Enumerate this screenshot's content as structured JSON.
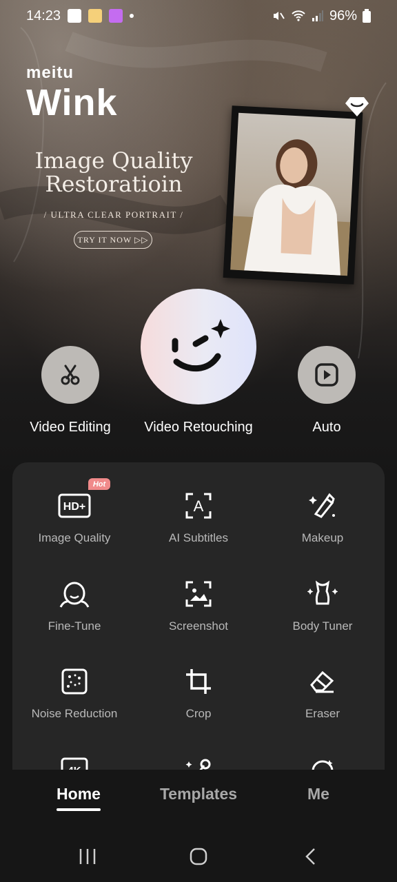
{
  "status_bar": {
    "time": "14:23",
    "battery": "96%"
  },
  "hero": {
    "brand_small": "meitu",
    "brand_big": "Wink",
    "promo_title_line1": "Image Quality",
    "promo_title_line2": "Restoratioin",
    "promo_subtitle": "/ ULTRA CLEAR PORTRAIT /",
    "cta_label": "TRY IT NOW ▷▷"
  },
  "actions": [
    {
      "label": "Video Editing",
      "icon": "scissors-icon"
    },
    {
      "label": "Video Retouching",
      "icon": "wink-face-icon"
    },
    {
      "label": "Auto",
      "icon": "play-icon"
    }
  ],
  "tools": [
    {
      "label": "Image Quality",
      "icon": "hd-plus-icon",
      "badge": "Hot"
    },
    {
      "label": "AI Subtitles",
      "icon": "subtitle-a-icon"
    },
    {
      "label": "Makeup",
      "icon": "lipstick-icon"
    },
    {
      "label": "Fine-Tune",
      "icon": "face-tune-icon"
    },
    {
      "label": "Screenshot",
      "icon": "screenshot-icon"
    },
    {
      "label": "Body Tuner",
      "icon": "body-icon"
    },
    {
      "label": "Noise Reduction",
      "icon": "noise-icon"
    },
    {
      "label": "Crop",
      "icon": "crop-icon"
    },
    {
      "label": "Eraser",
      "icon": "eraser-icon"
    }
  ],
  "bottom_nav": {
    "tabs": [
      {
        "label": "Home",
        "active": true
      },
      {
        "label": "Templates",
        "active": false
      },
      {
        "label": "Me",
        "active": false
      }
    ]
  },
  "colors": {
    "panel_bg": "#262626",
    "page_bg": "#161616",
    "hot_badge": "#f08a8a",
    "tool_label": "#b9b9b9"
  }
}
